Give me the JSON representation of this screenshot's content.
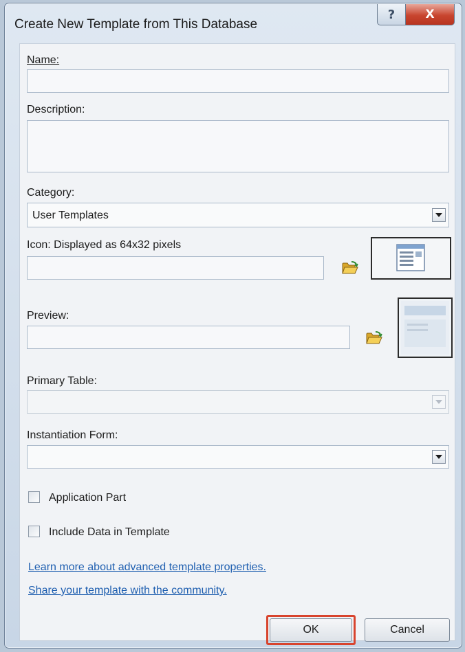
{
  "dialog": {
    "title": "Create New Template from This Database",
    "help_glyph": "?",
    "close_glyph": "X"
  },
  "form": {
    "name_label": "Name:",
    "name_value": "",
    "description_label": "Description:",
    "description_value": "",
    "category_label": "Category:",
    "category_value": "User Templates",
    "icon_label": "Icon: Displayed as 64x32 pixels",
    "icon_value": "",
    "preview_label": "Preview:",
    "preview_value": "",
    "primary_table_label": "Primary Table:",
    "primary_table_value": "",
    "instantiation_form_label": "Instantiation Form:",
    "instantiation_form_value": "",
    "application_part_label": "Application Part",
    "application_part_checked": false,
    "include_data_label": "Include Data in Template",
    "include_data_checked": false
  },
  "links": {
    "learn_more": "Learn more about advanced template properties.",
    "share": "Share your template with the community."
  },
  "buttons": {
    "ok": "OK",
    "cancel": "Cancel"
  },
  "icons": {
    "browse_icon": "folder-open-icon",
    "icon_thumbnail": "template-icon-thumbnail",
    "preview_thumbnail": "template-preview-thumbnail"
  },
  "colors": {
    "highlight": "#d8442e",
    "link": "#1f5fb0",
    "close": "#c8452f"
  }
}
